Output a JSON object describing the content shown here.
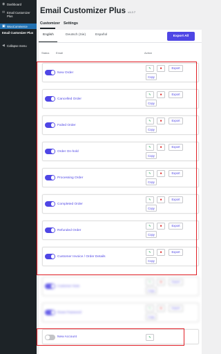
{
  "sidebar": {
    "dashboard": "Dashboard",
    "email_customizer_plus": "Email Customizer Plus",
    "woocommerce": "WooCommerce",
    "submenu_email_customizer_plus": "Email Customizer Plus",
    "collapse_menu": "Collapse menu"
  },
  "header": {
    "title": "Email Customizer Plus",
    "version": "v1.2.7"
  },
  "tabs": [
    "Customizer",
    "Settings"
  ],
  "languages": [
    "English",
    "Deutsch (Sie)",
    "Español"
  ],
  "export_all": "Export All",
  "table": {
    "col_status": "Status",
    "col_email": "Email",
    "col_action": "Action"
  },
  "actions": {
    "edit_icon": "pencil-icon",
    "delete_icon": "trash-icon",
    "export": "Export",
    "copy": "Copy"
  },
  "rows": [
    {
      "name": "New Order",
      "enabled": true
    },
    {
      "name": "Cancelled Order",
      "enabled": true
    },
    {
      "name": "Failed Order",
      "enabled": true
    },
    {
      "name": "Order On-hold",
      "enabled": true
    },
    {
      "name": "Processing Order",
      "enabled": true
    },
    {
      "name": "Completed Order",
      "enabled": true
    },
    {
      "name": "Refunded Order",
      "enabled": true
    },
    {
      "name": "Customer Invoice / Order Details",
      "enabled": true
    }
  ],
  "blurred_rows": [
    {
      "name": "Customer Note"
    },
    {
      "name": "Reset Password"
    }
  ],
  "new_account_row": {
    "name": "New Account",
    "enabled": false
  },
  "colors": {
    "accent": "#4f46e5",
    "sidebar_bg": "#1d2327",
    "sidebar_active": "#2271b1",
    "highlight": "#e11d24"
  }
}
